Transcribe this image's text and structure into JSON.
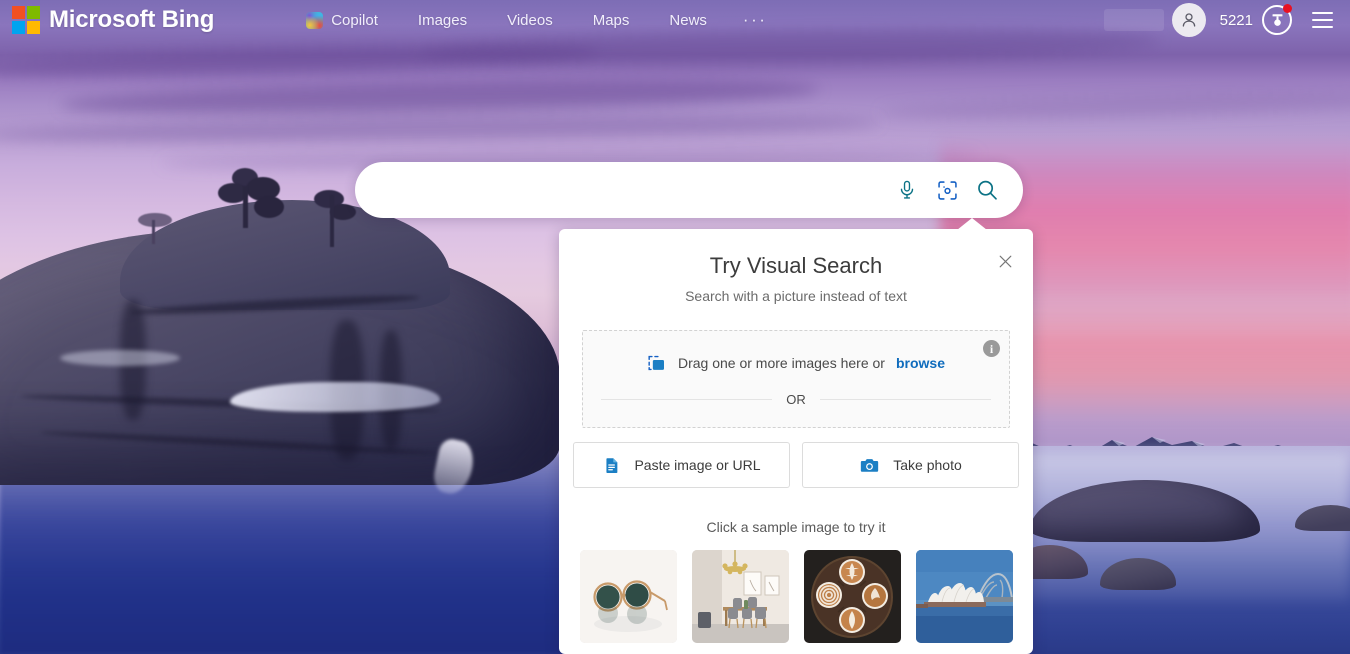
{
  "header": {
    "brand": "Microsoft Bing",
    "brand_logo_icon": "microsoft-logo-icon",
    "nav": [
      {
        "label": "Copilot",
        "icon": "copilot-icon"
      },
      {
        "label": "Images",
        "icon": ""
      },
      {
        "label": "Videos",
        "icon": ""
      },
      {
        "label": "Maps",
        "icon": ""
      },
      {
        "label": "News",
        "icon": ""
      },
      {
        "label": "···",
        "icon": "more-icon"
      }
    ],
    "avatar_icon": "user-avatar-icon",
    "rewards_count": "5221",
    "rewards_icon": "rewards-medal-icon",
    "rewards_has_notification": true,
    "menu_icon": "hamburger-menu-icon"
  },
  "search": {
    "value": "",
    "placeholder": "",
    "mic_icon": "microphone-icon",
    "visual_search_icon": "visual-search-lens-icon",
    "submit_icon": "search-magnifier-icon"
  },
  "visual_search_dialog": {
    "title": "Try Visual Search",
    "subtitle": "Search with a picture instead of text",
    "close_icon": "close-icon",
    "info_icon": "info-icon",
    "info_glyph": "i",
    "dropzone": {
      "image_icon": "drag-image-icon",
      "text_before": "Drag one or more images here or",
      "browse_label": "browse"
    },
    "divider_label": "OR",
    "buttons": [
      {
        "label": "Paste image or URL",
        "icon": "paste-document-icon"
      },
      {
        "label": "Take photo",
        "icon": "camera-icon"
      }
    ],
    "samples_label": "Click a sample image to try it",
    "samples": [
      {
        "name": "sunglasses",
        "alt": "Round green-lens sunglasses on white background"
      },
      {
        "name": "dining-room",
        "alt": "Modern dining room with chandelier and chairs"
      },
      {
        "name": "latte-art",
        "alt": "Four latte art coffee cups on a round wooden tray"
      },
      {
        "name": "sydney-opera-house",
        "alt": "Sydney Opera House and Harbour Bridge"
      }
    ]
  },
  "background": {
    "name": "bonsai-rock-lake-tahoe",
    "alt": "Purple and pink sunset sky over a large boulder in a calm blue lake",
    "colors": {
      "sky_top": "#7d6db5",
      "sky_mid": "#c8addc",
      "cloud_pink": "#e2769f",
      "water_deep": "#2a3a88",
      "rock_dark": "#3b3a58"
    }
  },
  "theme": {
    "accent_blue": "#0f6cbd",
    "teal": "#0b7285",
    "notification_red": "#e81123",
    "dialog_bg": "#ffffff",
    "dropzone_bg": "#fafafa"
  }
}
